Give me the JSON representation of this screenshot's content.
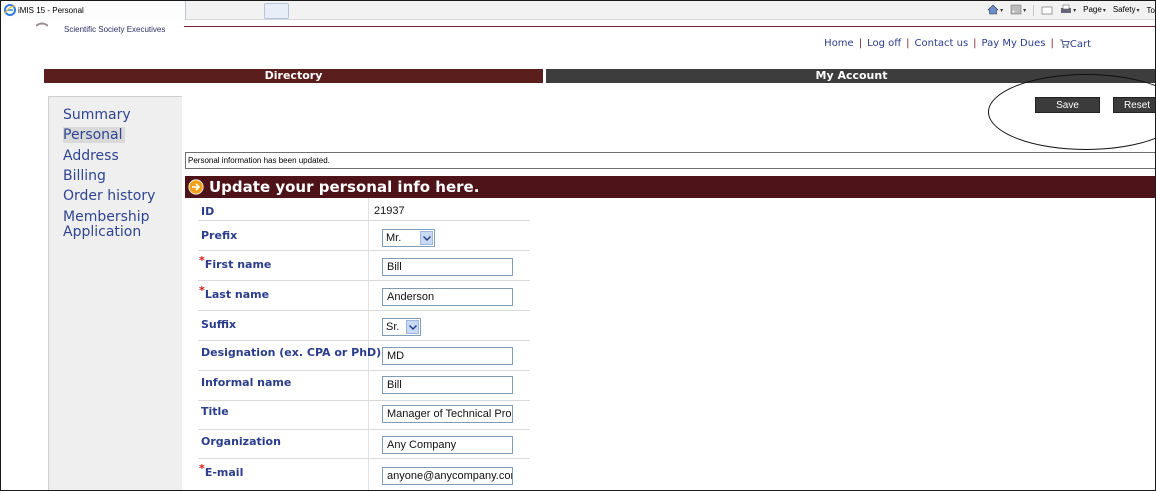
{
  "browser": {
    "tab_title": "iMIS 15 - Personal",
    "commands": [
      {
        "label": "Page",
        "icon": "page-icon"
      },
      {
        "label": "Safety",
        "icon": "safety-icon"
      },
      {
        "label": "To",
        "icon": "tools-icon"
      }
    ]
  },
  "site": {
    "society_name": "Scientific Society Executives",
    "links": [
      "Home",
      "Log off",
      "Contact us",
      "Pay My Dues",
      "Cart"
    ]
  },
  "nav": {
    "directory": "Directory",
    "my_account": "My Account"
  },
  "sidebar": {
    "items": [
      {
        "label": "Summary",
        "active": false
      },
      {
        "label": "Personal",
        "active": true
      },
      {
        "label": "Address",
        "active": false
      },
      {
        "label": "Billing",
        "active": false
      },
      {
        "label": "Order history",
        "active": false
      },
      {
        "label": "Membership",
        "active": false
      },
      {
        "label": "Application",
        "active": false
      }
    ]
  },
  "actions": {
    "save": "Save",
    "reset": "Reset"
  },
  "message": "Personal information has been updated.",
  "section_title": "Update your personal info here.",
  "form": {
    "id": {
      "label": "ID",
      "value": "21937"
    },
    "prefix": {
      "label": "Prefix",
      "value": "Mr."
    },
    "first_name": {
      "label": "First name",
      "value": "Bill",
      "required": true
    },
    "last_name": {
      "label": "Last name",
      "value": "Anderson",
      "required": true
    },
    "suffix": {
      "label": "Suffix",
      "value": "Sr."
    },
    "designation": {
      "label": "Designation (ex. CPA or PhD)",
      "value": "MD"
    },
    "informal_name": {
      "label": "Informal name",
      "value": "Bill"
    },
    "title": {
      "label": "Title",
      "value": "Manager of Technical Prog"
    },
    "organization": {
      "label": "Organization",
      "value": "Any Company"
    },
    "email": {
      "label": "E-mail",
      "value": "anyone@anycompany.cor",
      "required": true
    }
  },
  "colors": {
    "nav_directory": "#5a1e1c",
    "nav_account": "#3d3d3d",
    "section_header": "#4d1318",
    "link_blue": "#2f4591",
    "required": "#d21414"
  }
}
